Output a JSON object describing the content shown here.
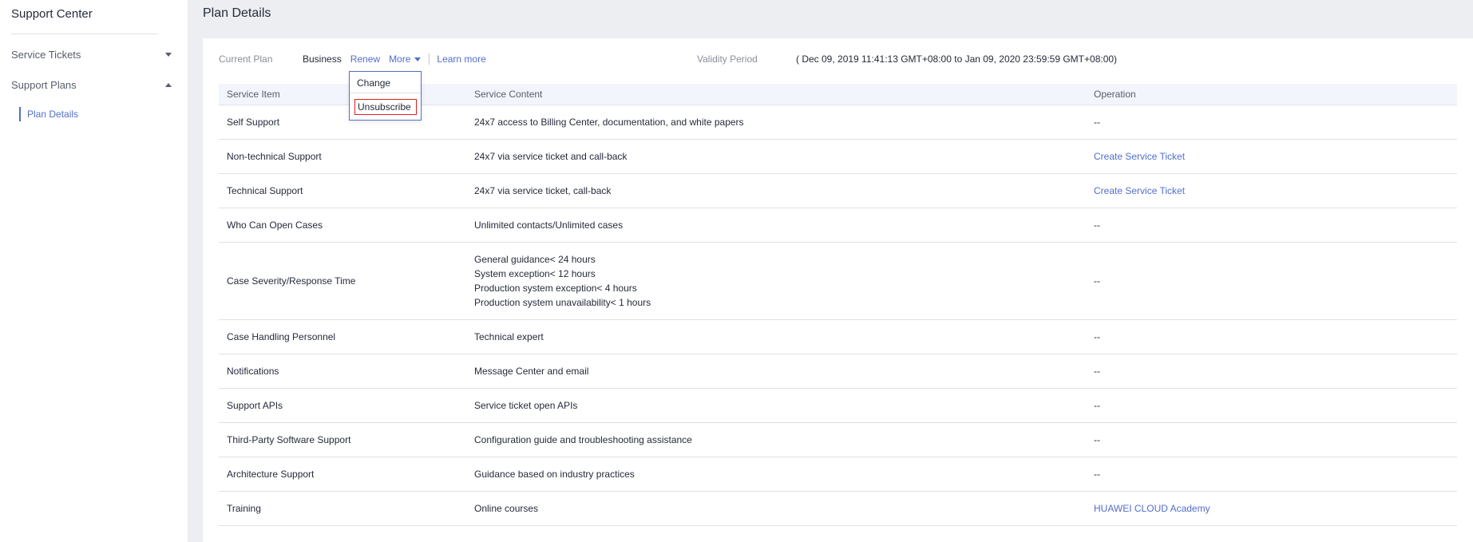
{
  "sidebar": {
    "title": "Support Center",
    "items": [
      {
        "label": "Service Tickets",
        "expanded": false
      },
      {
        "label": "Support Plans",
        "expanded": true
      }
    ],
    "sub_items": [
      {
        "label": "Plan Details",
        "active": true
      }
    ]
  },
  "page": {
    "title": "Plan Details"
  },
  "plan": {
    "current_label": "Current Plan",
    "name": "Business",
    "renew": "Renew",
    "more": "More",
    "learn_more": "Learn more",
    "validity_label": "Validity Period",
    "validity_value": "( Dec 09, 2019 11:41:13 GMT+08:00 to Jan 09, 2020 23:59:59 GMT+08:00)"
  },
  "more_menu": {
    "items": [
      "Change",
      "Unsubscribe"
    ]
  },
  "table": {
    "headers": [
      "Service Item",
      "Service Content",
      "Operation"
    ],
    "rows": [
      {
        "item": "Self Support",
        "content": [
          "24x7 access to Billing Center, documentation, and white papers"
        ],
        "operation": "--",
        "op_link": false
      },
      {
        "item": "Non-technical Support",
        "content": [
          "24x7 via service ticket and call-back"
        ],
        "operation": "Create Service Ticket",
        "op_link": true
      },
      {
        "item": "Technical Support",
        "content": [
          "24x7 via service ticket, call-back"
        ],
        "operation": "Create Service Ticket",
        "op_link": true
      },
      {
        "item": "Who Can Open Cases",
        "content": [
          "Unlimited contacts/Unlimited cases"
        ],
        "operation": "--",
        "op_link": false
      },
      {
        "item": "Case Severity/Response Time",
        "content": [
          "General guidance< 24 hours",
          "System exception< 12 hours",
          "Production system exception< 4 hours",
          "Production system unavailability< 1 hours"
        ],
        "operation": "--",
        "op_link": false
      },
      {
        "item": "Case Handling Personnel",
        "content": [
          "Technical expert"
        ],
        "operation": "--",
        "op_link": false
      },
      {
        "item": "Notifications",
        "content": [
          "Message Center and email"
        ],
        "operation": "--",
        "op_link": false
      },
      {
        "item": "Support APIs",
        "content": [
          "Service ticket open APIs"
        ],
        "operation": "--",
        "op_link": false
      },
      {
        "item": "Third-Party Software Support",
        "content": [
          "Configuration guide and troubleshooting assistance"
        ],
        "operation": "--",
        "op_link": false
      },
      {
        "item": "Architecture Support",
        "content": [
          "Guidance based on industry practices"
        ],
        "operation": "--",
        "op_link": false
      },
      {
        "item": "Training",
        "content": [
          "Online courses"
        ],
        "operation": "HUAWEI CLOUD Academy",
        "op_link": true
      }
    ]
  },
  "colors": {
    "link": "#526ecc",
    "highlight_border": "#e0201e",
    "header_bg": "#f2f5fc",
    "page_bg": "#eceef2"
  }
}
